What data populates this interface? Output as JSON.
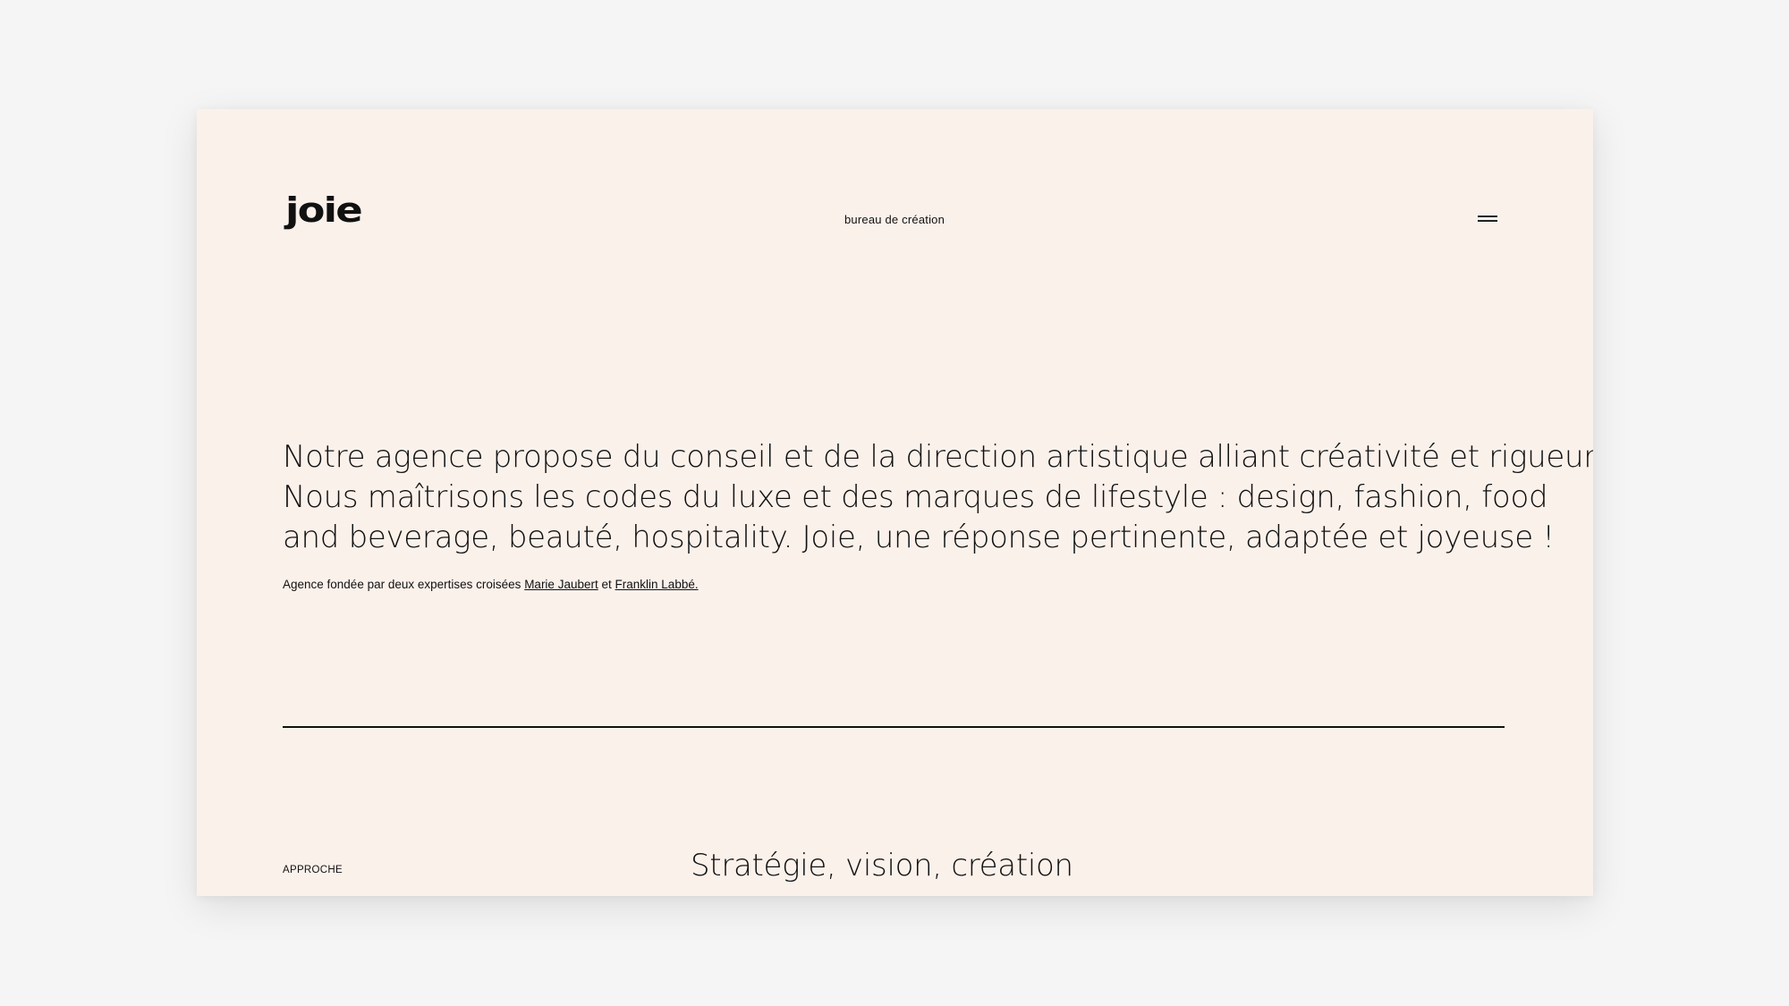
{
  "header": {
    "logo_text": "joie",
    "tagline": "bureau de création",
    "menu_icon": "hamburger-menu-icon"
  },
  "intro": {
    "lines": [
      "Notre agence propose du conseil et de la direction artistique alliant créativité et rigueur.",
      "Nous maîtrisons les codes du luxe et des marques de lifestyle : design, fashion, food",
      "and beverage, beauté, hospitality. Joie, une réponse pertinente, adaptée et joyeuse !"
    ]
  },
  "founders": {
    "prefix": "Agence fondée par deux expertises croisées",
    "founder1": "Marie Jaubert",
    "conjunction": "et",
    "founder2": "Franklin Labbé."
  },
  "section": {
    "label": "APPROCHE",
    "heading": "Stratégie, vision, création"
  },
  "colors": {
    "page_background": "#f5f5f5",
    "card_background": "#fbf1eb",
    "text": "#111111"
  }
}
